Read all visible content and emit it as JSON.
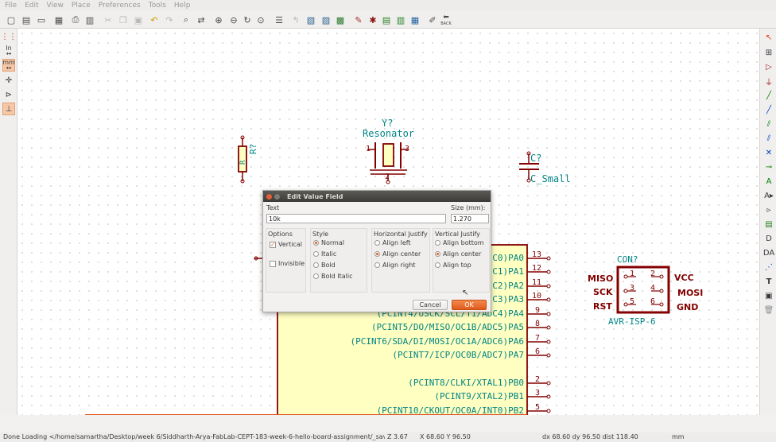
{
  "menu": [
    "File",
    "Edit",
    "View",
    "Place",
    "Preferences",
    "Tools",
    "Help"
  ],
  "toolbar": {
    "back_label": "BACK",
    "icons": [
      "new-icon",
      "open-icon",
      "save-icon",
      "page-settings-icon",
      "print-icon",
      "plot-icon",
      "cut-icon",
      "copy-icon",
      "paste-icon",
      "undo-icon",
      "redo-icon",
      "find-icon",
      "find-replace-icon",
      "zoom-in-icon",
      "zoom-out-icon",
      "redraw-icon",
      "zoom-fit-icon",
      "hierarchy-icon",
      "leave-sheet-icon",
      "library-editor-icon",
      "library-browser-icon",
      "module-editor-icon",
      "annotate-icon",
      "erc-icon",
      "netlist-icon",
      "bom-icon",
      "cvpcb-icon",
      "pcbnew-icon",
      "import-footprint-icon"
    ]
  },
  "left_toolbar": {
    "units_in": "In",
    "units_mm": "mm"
  },
  "schematic": {
    "resistor": {
      "ref": "R?",
      "value": "R"
    },
    "resonator": {
      "ref": "Y?",
      "value": "Resonator",
      "pin1": "1",
      "pin2": "2",
      "pin3": "3"
    },
    "capacitor": {
      "ref": "C?",
      "value": "C_Small"
    },
    "connector": {
      "ref": "CON?",
      "value": "AVR-ISP-6",
      "left_pins": [
        "MISO",
        "SCK",
        "RST"
      ],
      "right_pins": [
        "VCC",
        "MOSI",
        "GND"
      ],
      "pin_numbers": [
        [
          "1",
          "2"
        ],
        [
          "3",
          "4"
        ],
        [
          "5",
          "6"
        ]
      ]
    },
    "ic_pins": [
      {
        "label": "C0)PA0",
        "num": "13"
      },
      {
        "label": "C1)PA1",
        "num": "12"
      },
      {
        "label": "C2)PA2",
        "num": "11"
      },
      {
        "label": "C3)PA3",
        "num": "10"
      },
      {
        "label": "(PCINT4/USCK/SCL/T1/ADC4)PA4",
        "num": "9"
      },
      {
        "label": "(PCINT5/DO/MISO/OC1B/ADC5)PA5",
        "num": "8"
      },
      {
        "label": "(PCINT6/SDA/DI/MOSI/OC1A/ADC6)PA6",
        "num": "7"
      },
      {
        "label": "(PCINT7/ICP/OC0B/ADC7)PA7",
        "num": "6"
      },
      {
        "label": "(PCINT8/CLKI/XTAL1)PB0",
        "num": "2"
      },
      {
        "label": "(PCINT9/XTAL2)PB1",
        "num": "3"
      },
      {
        "label": "(PCINT10/CKOUT/OC0A/INT0)PB2",
        "num": "5"
      }
    ]
  },
  "dialog": {
    "title": "Edit Value Field",
    "text_label": "Text",
    "text_value": "10k",
    "size_label": "Size (mm):",
    "size_value": "1.270",
    "options_label": "Options",
    "vertical_label": "Vertical",
    "invisible_label": "Invisible",
    "style_label": "Style",
    "style_options": [
      "Normal",
      "Italic",
      "Bold",
      "Bold Italic"
    ],
    "hjustify_label": "Horizontal Justify",
    "hjustify_options": [
      "Align left",
      "Align center",
      "Align right"
    ],
    "vjustify_label": "Vertical Justify",
    "vjustify_options": [
      "Align bottom",
      "Align center",
      "Align top"
    ],
    "cancel_label": "Cancel",
    "ok_label": "OK"
  },
  "statusbar": {
    "message": "Done Loading </home/samartha/Desktop/week 6/Siddharth-Arya-FabLab-CEPT-183-week-6-hello-board-assignment/_saved_Si...",
    "zoom": "Z 3.67",
    "xy": "X 68.60  Y 96.50",
    "delta": "dx 68.60  dy 96.50  dist 118.40",
    "units": "mm"
  },
  "colors": {
    "symbol_body": "#840000",
    "symbol_fill": "#ffffc2",
    "text_field": "#008484",
    "pin_name": "#840000",
    "ok_button": "#df5b1c"
  }
}
